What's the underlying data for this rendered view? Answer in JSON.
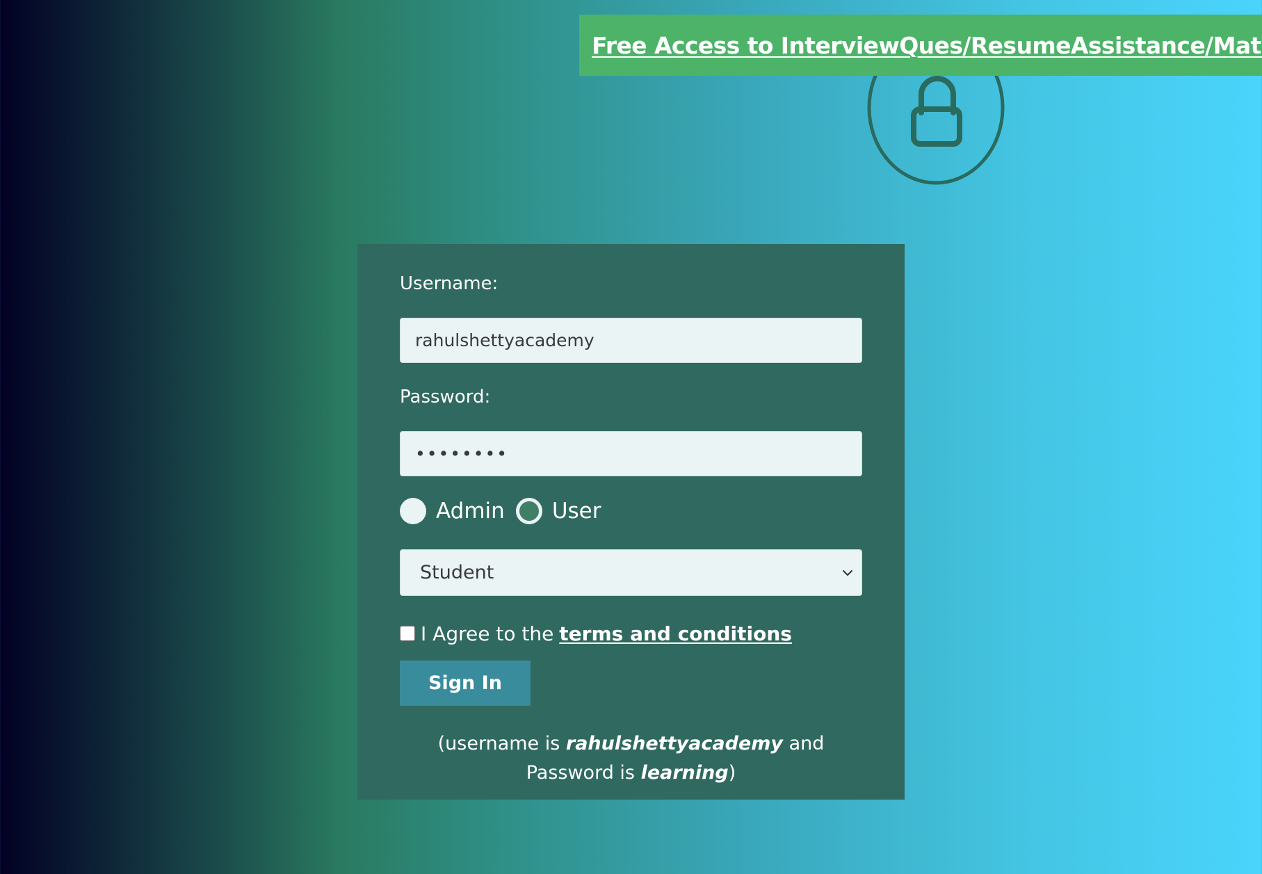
{
  "banner": {
    "link_text": "Free Access to InterviewQues/ResumeAssistance/Material"
  },
  "logo": {
    "icon": "lock-icon"
  },
  "form": {
    "username_label": "Username:",
    "username_value": "rahulshettyacademy",
    "password_label": "Password:",
    "password_value": "learning",
    "radios": [
      {
        "label": "Admin",
        "checked": false
      },
      {
        "label": "User",
        "checked": true
      }
    ],
    "select": {
      "selected": "Student"
    },
    "terms": {
      "checked": false,
      "prefix": "I Agree to the",
      "link_text": "terms and conditions"
    },
    "signin_label": "Sign In",
    "hint": {
      "part1": "(username is",
      "username": "rahulshettyacademy",
      "part2": "and Password is",
      "password": "learning",
      "part3": ")"
    }
  },
  "colors": {
    "banner_bg": "#4cb368",
    "card_bg": "#30695f",
    "button_bg": "#398c9b",
    "logo_stroke": "#2a6b5e"
  }
}
